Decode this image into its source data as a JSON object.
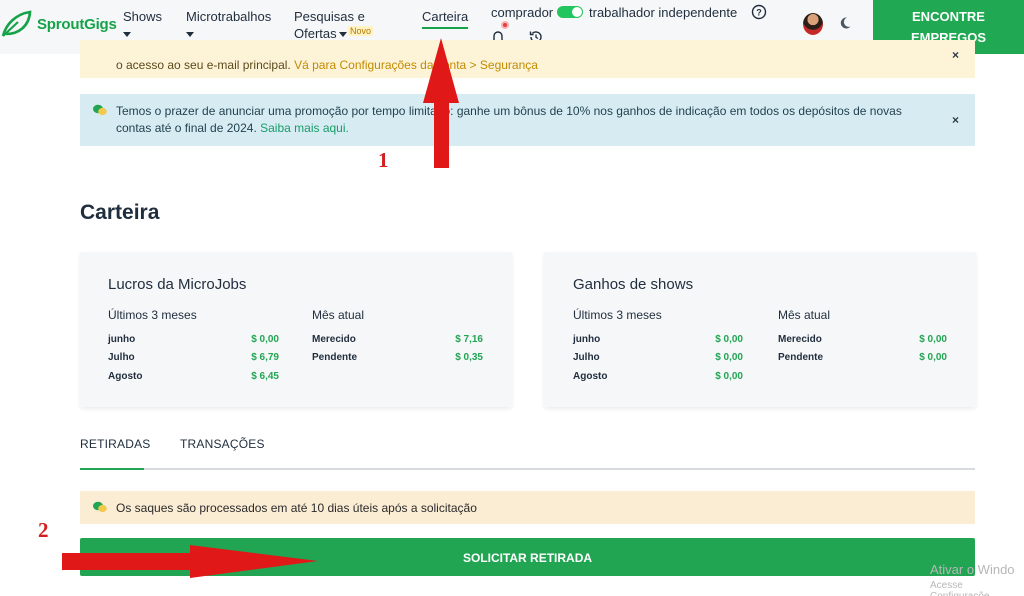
{
  "header": {
    "logo_text": "SproutGigs",
    "nav": {
      "shows": "Shows",
      "microtrabalhos": "Microtrabalhos",
      "pesquisas_l1": "Pesquisas e",
      "pesquisas_l2": "Ofertas",
      "novo_badge": "Novo",
      "carteira": "Carteira"
    },
    "role_buyer": "comprador",
    "role_worker": "trabalhador independente",
    "cta_l1": "ENCONTRE",
    "cta_l2": "EMPREGOS"
  },
  "alerts": {
    "email_text": "o acesso ao seu e-mail principal.",
    "email_link": "Vá para Configurações da conta > Segurança",
    "promo_text": "Temos o prazer de anunciar uma promoção por tempo limitado: ganhe um bônus de 10% nos ganhos de indicação em todos os depósitos de novas contas até o final de 2024.",
    "promo_link": "Saiba mais aqui.",
    "close_symbol": "×"
  },
  "page_title": "Carteira",
  "cards": {
    "microjobs": {
      "title": "Lucros da MicroJobs",
      "last3_header": "Últimos 3 meses",
      "current_header": "Mês atual",
      "last3": [
        {
          "label": "junho",
          "value": "$ 0,00"
        },
        {
          "label": "Julho",
          "value": "$ 6,79"
        },
        {
          "label": "Agosto",
          "value": "$ 6,45"
        }
      ],
      "current": [
        {
          "label": "Merecido",
          "value": "$ 7,16"
        },
        {
          "label": "Pendente",
          "value": "$ 0,35"
        }
      ]
    },
    "shows": {
      "title": "Ganhos de shows",
      "last3_header": "Últimos 3 meses",
      "current_header": "Mês atual",
      "last3": [
        {
          "label": "junho",
          "value": "$ 0,00"
        },
        {
          "label": "Julho",
          "value": "$ 0,00"
        },
        {
          "label": "Agosto",
          "value": "$ 0,00"
        }
      ],
      "current": [
        {
          "label": "Merecido",
          "value": "$ 0,00"
        },
        {
          "label": "Pendente",
          "value": "$ 0,00"
        }
      ]
    }
  },
  "tabs": {
    "retiradas": "RETIRADAS",
    "transacoes": "TRANSAÇÕES"
  },
  "notice": "Os saques são processados em até 10 dias úteis após a solicitação",
  "withdraw_button": "SOLICITAR RETIRADA",
  "annotations": {
    "n1": "1",
    "n2": "2"
  },
  "watermark": {
    "line1": "Ativar o Windo",
    "line2": "Acesse Configuraçõe"
  },
  "colors": {
    "accent_green": "#22a553",
    "arrow_red": "#e01818"
  }
}
